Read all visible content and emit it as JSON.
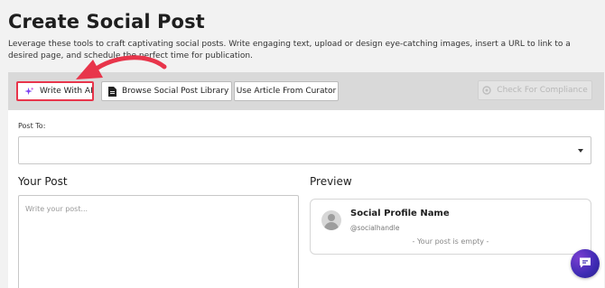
{
  "header": {
    "title": "Create Social Post",
    "description": "Leverage these tools to craft captivating social posts. Write engaging text, upload or design eye-catching images, insert a URL to link to a desired page, and schedule the perfect time for publication."
  },
  "toolbar": {
    "write_ai_label": "Write With AI",
    "library_label": "Browse Social Post Library",
    "curator_label": "Use Article From Curator",
    "compliance_label": "Check For Compliance"
  },
  "form": {
    "post_to_label": "Post To:",
    "post_to_value": "",
    "your_post_heading": "Your Post",
    "post_placeholder": "Write your post..."
  },
  "preview": {
    "heading": "Preview",
    "profile_name": "Social Profile Name",
    "handle": "@socialhandle",
    "empty_message": "- Your post is empty -"
  },
  "colors": {
    "highlight": "#e8354b",
    "annotation_arrow": "#e8354b",
    "chat_button": "#4a2fc0"
  }
}
